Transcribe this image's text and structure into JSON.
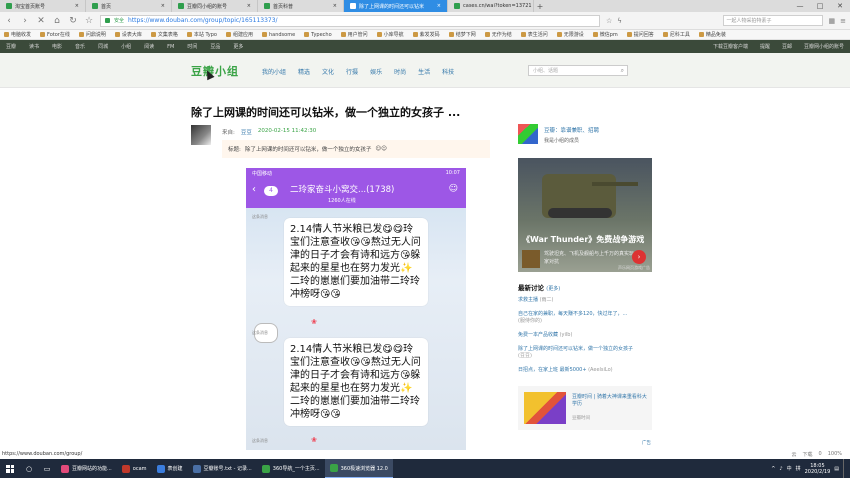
{
  "browser": {
    "tabs": [
      {
        "title": "淘宝首页账号"
      },
      {
        "title": "首页"
      },
      {
        "title": "豆瓣同小组的账号"
      },
      {
        "title": "首页科普"
      },
      {
        "title": "除了上网课的时间还可以钻米",
        "active": true
      },
      {
        "title": "cases.cn/wai?token=13721"
      }
    ],
    "url_secure_label": "安全",
    "url": "https://www.douban.com/group/topic/165113373/",
    "search_placeholder": "一起人物采拍特素子",
    "bookmarks": [
      "电脑收发",
      "Fotor在线",
      "问鼎说明",
      "设表大库",
      "文集表格",
      "本站 Typo",
      "组建应用",
      "handsome",
      "Typecho",
      "用户管问",
      "小库导航",
      "紫发发码",
      "结梦下网",
      "无作为结",
      "表生活问",
      "无限游设",
      "微信pm",
      "提问回答",
      "尼科工具",
      "精品免装"
    ]
  },
  "douban_nav": {
    "items": [
      "豆瓣",
      "读书",
      "电影",
      "音乐",
      "同城",
      "小组",
      "阅读",
      "FM",
      "时间",
      "豆品",
      "更多"
    ],
    "right": [
      "下载豆瓣客户端",
      "提醒",
      "豆邮",
      "豆瓣网小组的账号"
    ]
  },
  "group_header": {
    "logo": "豆瓣小组",
    "nav": [
      "我的小组",
      "精选",
      "文化",
      "行摄",
      "娱乐",
      "时尚",
      "生活",
      "科技"
    ],
    "search_placeholder": "小组、话题"
  },
  "topic": {
    "title": "除了上网课的时间还可以钻米，做一个独立的女孩子 ...",
    "author_prefix": "来自:",
    "author": "豆豆",
    "time": "2020-02-15 11:42:30",
    "quote_label": "标题:",
    "quote": "除了上网课的时间还可以钻米，做一个独立的女孩子"
  },
  "phone": {
    "carrier": "中国移动",
    "clock": "10:07",
    "back_badge": "4",
    "group_name": "二玲家奋斗小窝交...(1738)",
    "online": "1260人在线",
    "message": "2.14情人节米粮已发😋😋玲宝们注意查收😘😘熬过无人问津的日子才会有诗和远方😘躲起来的星星也在努力发光✨二玲的崽崽们要加油带二玲玲冲榜呀😘😘",
    "sender1": "这条消息",
    "sender2": "这条消息"
  },
  "sidebar": {
    "group_name": "豆瓣：靠谱兼职、招聘",
    "group_sub": "我是小组的成员",
    "ad": {
      "headline": "《War Thunder》免费战争游戏",
      "desc": "驾驶坦克、飞机及舰船与上千万的真实玩家对抗",
      "tag": "声乐网页游戏广告"
    },
    "discussion_title": "最新讨论",
    "discussion_more": "(更多)",
    "discussions": [
      {
        "title": "求救主播",
        "count": "(雨二)"
      },
      {
        "title": "自己在家的兼职，每天赚不多120，快过年了，...",
        "count": "(服侍你的)"
      },
      {
        "title": "免费一本产品收藏",
        "count": "(yilb)"
      },
      {
        "title": "除了上网课的时间还可以钻米，做一个独立的女孩子",
        "count": "(豆豆)"
      },
      {
        "title": "日招点，在家上班 最新5000+",
        "count": "(AeelsiLo)"
      }
    ],
    "promo": {
      "title": "豆瓣时间 | 骑着大神课来重看科大学历",
      "sub": "豆瓣时间"
    },
    "ad_small": "广告"
  },
  "status_url": "https://www.douban.com/group/",
  "status_right": [
    "云",
    "下载",
    "0",
    "100%"
  ],
  "taskbar": {
    "apps": [
      {
        "label": "豆瓣网站的功能...",
        "color": "#e34b7b"
      },
      {
        "label": "ocam",
        "color": "#c0392b"
      },
      {
        "label": "表创建",
        "color": "#3b7ddd"
      },
      {
        "label": "豆瓣账号.txt - 记录...",
        "color": "#4a6fa5"
      },
      {
        "label": "360导航_一个主页...",
        "color": "#3aa346"
      },
      {
        "label": "360极速浏览器 12.0",
        "color": "#3aa346",
        "active": true
      }
    ],
    "tray": [
      "^",
      "中",
      "拼"
    ],
    "time": "18:05",
    "date": "2020/2/19"
  }
}
